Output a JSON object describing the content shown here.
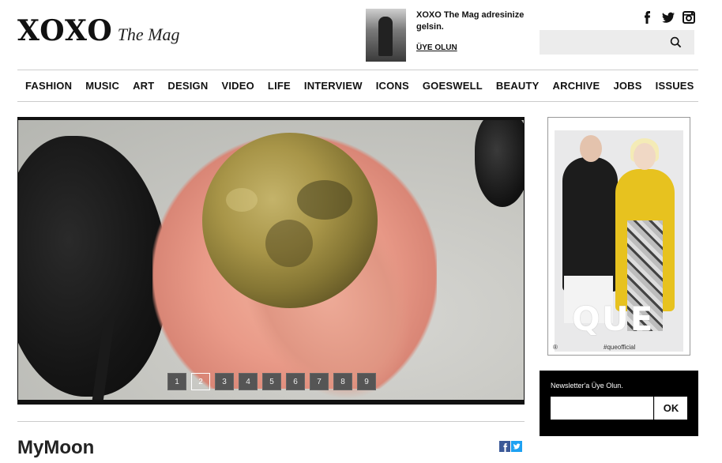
{
  "header": {
    "logo_main": "XOXO",
    "logo_sub": "The Mag"
  },
  "promo": {
    "text": "XOXO The Mag adresinize gelsin.",
    "link": "ÜYE OLUN"
  },
  "social": [
    "facebook-icon",
    "twitter-icon",
    "instagram-icon"
  ],
  "search": {
    "placeholder": ""
  },
  "nav": {
    "items": [
      "FASHION",
      "MUSIC",
      "ART",
      "DESIGN",
      "VIDEO",
      "LIFE",
      "INTERVIEW",
      "ICONS",
      "GOESWELL",
      "BEAUTY",
      "ARCHIVE",
      "JOBS",
      "ISSUES"
    ]
  },
  "slider": {
    "pages": [
      "1",
      "2",
      "3",
      "4",
      "5",
      "6",
      "7",
      "8",
      "9"
    ],
    "active_page": "2"
  },
  "article": {
    "title": "MyMoon"
  },
  "ad": {
    "brand": "QUE",
    "tag": "#queofficial",
    "mark": "®"
  },
  "newsletter": {
    "label": "Newsletter'a Üye Olun.",
    "button": "OK"
  }
}
